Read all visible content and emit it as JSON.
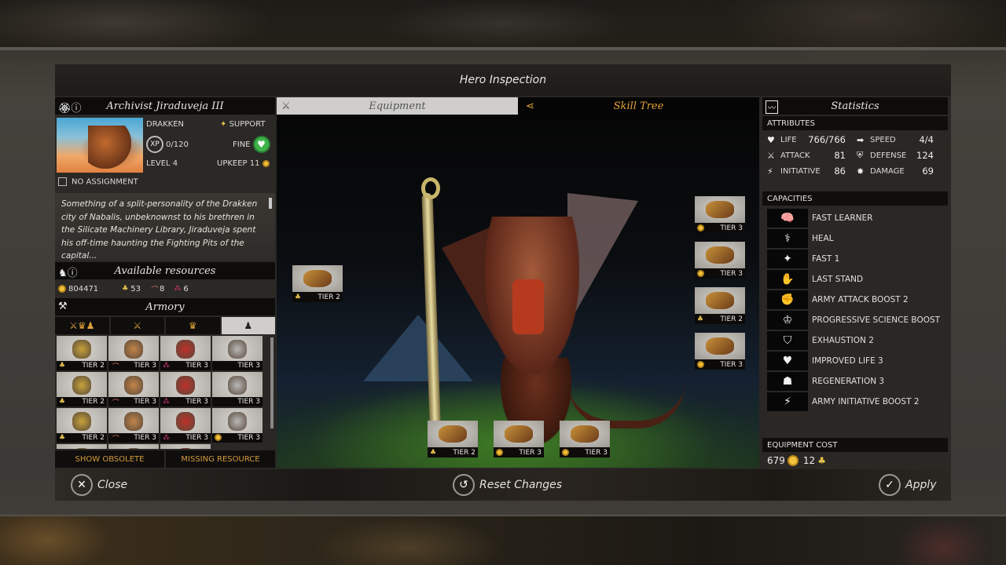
{
  "window": {
    "title": "Hero Inspection"
  },
  "hero": {
    "name": "Archivist Jiraduveja III",
    "faction": "DRAKKEN",
    "role": "SUPPORT",
    "xp": "0/120",
    "xp_badge": "XP",
    "status": "FINE",
    "level": "LEVEL 4",
    "upkeep": "UPKEEP 11",
    "assignment": "NO ASSIGNMENT",
    "bio": "Something of a split-personality of the Drakken city of Nabalis, unbeknownst to his brethren in the Silicate Machinery Library, Jiraduveja spent his off-time haunting the Fighting Pits of the capital..."
  },
  "resources": {
    "title": "Available resources",
    "dust": "804471",
    "food": "53",
    "luxury": "8",
    "strategic": "6"
  },
  "armory": {
    "title": "Armory",
    "tabs": [
      {
        "label": "⚔♛♟",
        "name": "all",
        "active": false
      },
      {
        "label": "⚔",
        "name": "weapons",
        "active": false
      },
      {
        "label": "♛",
        "name": "armor",
        "active": false
      },
      {
        "label": "♟",
        "name": "accessories",
        "active": true
      }
    ],
    "items": [
      {
        "res": "food",
        "tier": "TIER 2"
      },
      {
        "res": "luxury",
        "tier": "TIER 3"
      },
      {
        "res": "strategic",
        "tier": "TIER 3"
      },
      {
        "res": "",
        "tier": "TIER 3"
      },
      {
        "res": "food",
        "tier": "TIER 2"
      },
      {
        "res": "luxury",
        "tier": "TIER 3"
      },
      {
        "res": "strategic",
        "tier": "TIER 3"
      },
      {
        "res": "",
        "tier": "TIER 3"
      },
      {
        "res": "food",
        "tier": "TIER 2"
      },
      {
        "res": "luxury",
        "tier": "TIER 3"
      },
      {
        "res": "strategic",
        "tier": "TIER 3"
      },
      {
        "res": "dust",
        "tier": "TIER 3"
      },
      {
        "res": "",
        "tier": ""
      },
      {
        "res": "",
        "tier": ""
      },
      {
        "res": "",
        "tier": ""
      }
    ],
    "show_obsolete": "SHOW OBSOLETE",
    "missing_resource": "MISSING RESOURCE"
  },
  "tabs": {
    "equipment": "Equipment",
    "skill_tree": "Skill Tree"
  },
  "equipment_slots": [
    {
      "name": "slot-weapon-offhand",
      "res": "food",
      "tier": "TIER 2"
    },
    {
      "name": "slot-helmet",
      "res": "dust",
      "tier": "TIER 3"
    },
    {
      "name": "slot-chest",
      "res": "dust",
      "tier": "TIER 3"
    },
    {
      "name": "slot-weapon-main",
      "res": "food",
      "tier": "TIER 2"
    },
    {
      "name": "slot-gloves",
      "res": "dust",
      "tier": "TIER 3"
    },
    {
      "name": "slot-boots",
      "res": "food",
      "tier": "TIER 2"
    },
    {
      "name": "slot-accessory-1",
      "res": "dust",
      "tier": "TIER 3"
    },
    {
      "name": "slot-accessory-2",
      "res": "dust",
      "tier": "TIER 3"
    }
  ],
  "statistics": {
    "title": "Statistics",
    "attributes_label": "ATTRIBUTES",
    "attributes": [
      {
        "icon": "♥",
        "name": "LIFE",
        "value": "766/766"
      },
      {
        "icon": "➡",
        "name": "SPEED",
        "value": "4/4"
      },
      {
        "icon": "⚔",
        "name": "ATTACK",
        "value": "81"
      },
      {
        "icon": "⛨",
        "name": "DEFENSE",
        "value": "124"
      },
      {
        "icon": "⚡",
        "name": "INITIATIVE",
        "value": "86"
      },
      {
        "icon": "✸",
        "name": "DAMAGE",
        "value": "69"
      }
    ],
    "capacities_label": "CAPACITIES",
    "capacities": [
      {
        "icon": "🧠",
        "label": "FAST LEARNER"
      },
      {
        "icon": "⚕",
        "label": "HEAL"
      },
      {
        "icon": "✦",
        "label": "FAST 1"
      },
      {
        "icon": "✋",
        "label": "LAST STAND"
      },
      {
        "icon": "✊",
        "label": "ARMY ATTACK BOOST 2"
      },
      {
        "icon": "♔",
        "label": "PROGRESSIVE SCIENCE BOOST"
      },
      {
        "icon": "⛉",
        "label": "EXHAUSTION 2"
      },
      {
        "icon": "♥",
        "label": "IMPROVED LIFE 3"
      },
      {
        "icon": "☗",
        "label": "REGENERATION 3"
      },
      {
        "icon": "⚡",
        "label": "ARMY INITIATIVE BOOST 2"
      }
    ],
    "cost_label": "EQUIPMENT COST",
    "cost_dust": "679",
    "cost_food": "12"
  },
  "buttons": {
    "close": "Close",
    "reset": "Reset Changes",
    "apply": "Apply"
  },
  "colors": {
    "accent_gold": "#e7a33a",
    "fine_green": "#3db34a",
    "dust_yellow": "#f2c23c",
    "luxury_salmon": "#e7836b",
    "strategic_pink": "#d83a7a"
  }
}
